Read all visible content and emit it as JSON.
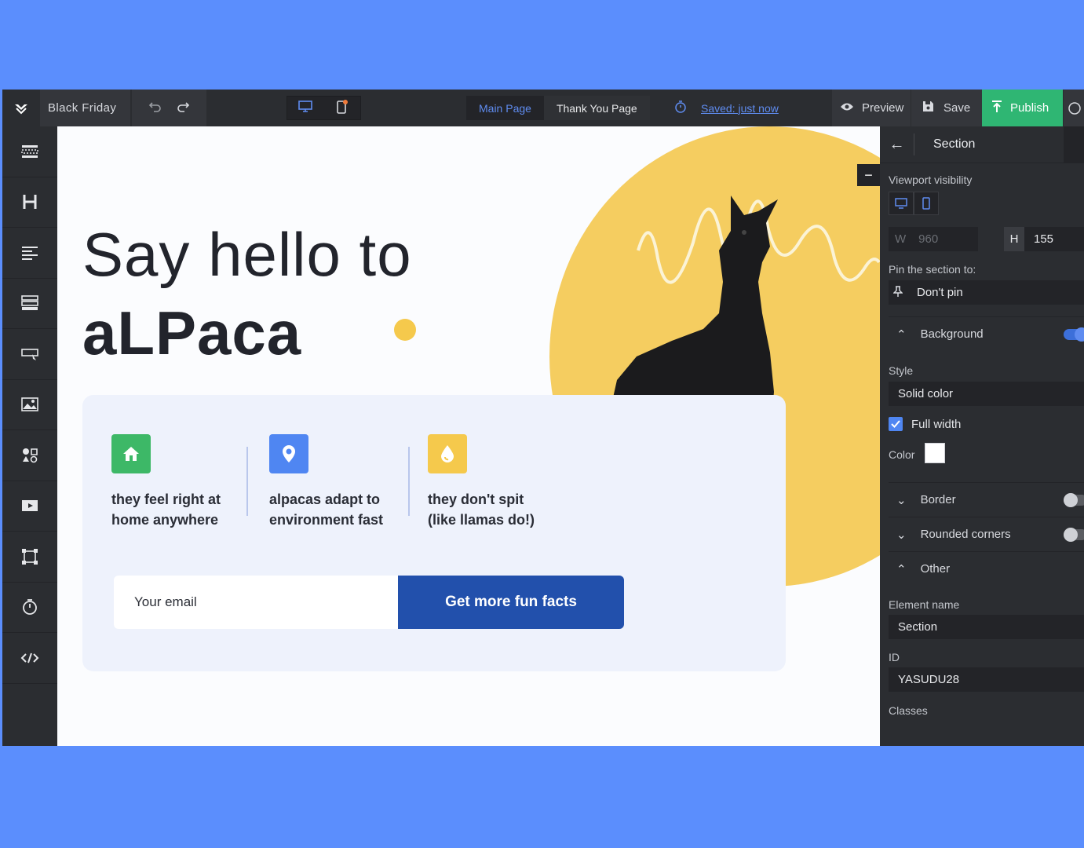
{
  "topbar": {
    "project_name": "Black Friday",
    "pages": [
      "Main Page",
      "Thank You Page"
    ],
    "saved_text": "Saved: just now",
    "preview_label": "Preview",
    "save_label": "Save",
    "publish_label": "Publish"
  },
  "canvas": {
    "headline_line1": "Say hello to",
    "headline_line2": "aLPaca",
    "features": [
      {
        "line1": "they feel right at",
        "line2": "home anywhere",
        "color": "#3db867"
      },
      {
        "line1": "alpacas adapt to",
        "line2": "environment fast",
        "color": "#4f86f2"
      },
      {
        "line1": "they don't spit",
        "line2": "(like llamas do!)",
        "color": "#f5c94c"
      }
    ],
    "email_placeholder": "Your email",
    "cta_label": "Get more fun facts",
    "collapse_symbol": "−"
  },
  "panel": {
    "title": "Section",
    "viewport_label": "Viewport visibility",
    "w_label": "W",
    "w_value": "960",
    "h_label": "H",
    "h_value": "155",
    "pin_label": "Pin the section to:",
    "pin_value": "Don't pin",
    "background_label": "Background",
    "style_label": "Style",
    "style_value": "Solid color",
    "full_width_label": "Full width",
    "color_label": "Color",
    "border_label": "Border",
    "rounded_label": "Rounded corners",
    "other_label": "Other",
    "element_name_label": "Element name",
    "element_name_value": "Section",
    "id_label": "ID",
    "id_value": "YASUDU28",
    "classes_label": "Classes"
  },
  "colors": {
    "background": "#5b8efd",
    "publish": "#2fb673",
    "accent": "#5f8cf0",
    "sun": "#f5cd60",
    "cta": "#2250ac"
  }
}
